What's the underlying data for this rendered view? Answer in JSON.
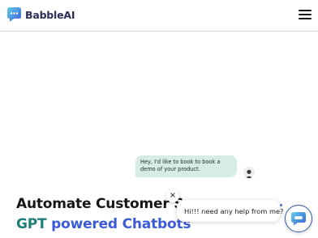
{
  "header": {
    "brand": "BabbleAI",
    "logo_icon": "chat-bubble-logo-icon",
    "menu_icon": "hamburger-menu-icon"
  },
  "hero": {
    "chat_message": "Hey, I'd like to book to book a demo of your product.",
    "headline": "Automate Customer Sup",
    "subline_gpt": "GPT",
    "subline_rest": "powered Chatbots"
  },
  "widget": {
    "close_label": "×",
    "greeting": "Hi!!! need any help from me?",
    "launcher_icon": "chatbot-launcher-icon"
  },
  "colors": {
    "brand_gradient_start": "#5fc8f0",
    "brand_gradient_end": "#3b63d4",
    "gpt": "#1e7f7a",
    "powered": "#3b5bdb",
    "chat_bubble_bg": "#d5ece7"
  }
}
